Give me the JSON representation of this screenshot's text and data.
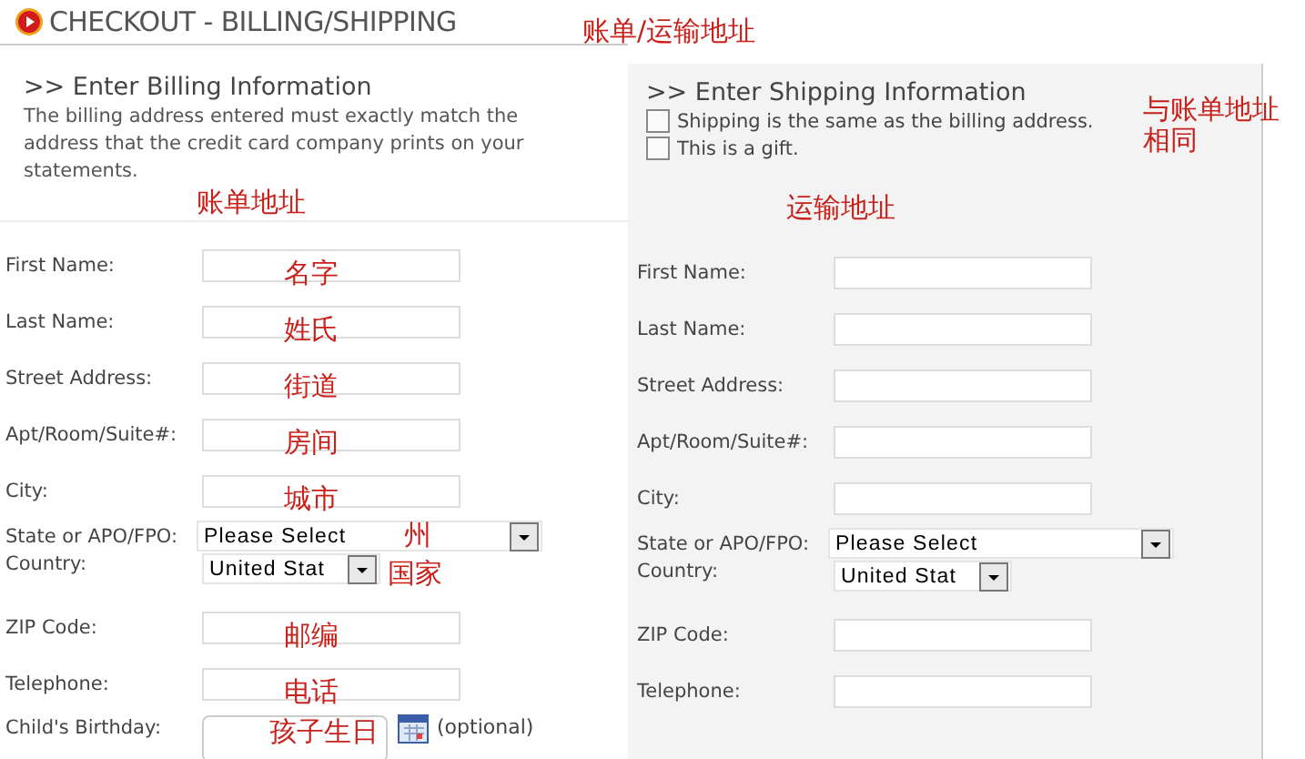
{
  "header": {
    "title": "CHECKOUT - BILLING/SHIPPING",
    "note": "账单/运输地址"
  },
  "billing": {
    "heading": ">> Enter Billing Information",
    "description": "The billing address entered must exactly match the address that the credit card company prints on your statements.",
    "note": "账单地址",
    "fields": [
      {
        "kind": "text",
        "label": "First Name:",
        "note": "名字"
      },
      {
        "kind": "text",
        "label": "Last Name:",
        "note": "姓氏"
      },
      {
        "kind": "text",
        "label": "Street Address:",
        "note": "街道"
      },
      {
        "kind": "text",
        "label": "Apt/Room/Suite#:",
        "note": "房间"
      },
      {
        "kind": "text",
        "label": "City:",
        "note": "城市"
      },
      {
        "kind": "select",
        "label": "State or APO/FPO:",
        "value": "Please Select",
        "note": "州"
      },
      {
        "kind": "country",
        "label": "Country:",
        "value": "United Stat",
        "note": "国家"
      },
      {
        "kind": "text",
        "label": "ZIP Code:",
        "note": "邮编"
      },
      {
        "kind": "text",
        "label": "Telephone:",
        "note": "电话"
      },
      {
        "kind": "date",
        "label": "Child's Birthday:",
        "hint": "(optional)",
        "note": "孩子生日"
      }
    ]
  },
  "shipping": {
    "heading": ">> Enter Shipping Information",
    "options": [
      {
        "label": "Shipping is the same as the billing address.",
        "checked": false
      },
      {
        "label": "This is a gift.",
        "checked": false
      }
    ],
    "options_note": "与账单地址相同",
    "note": "运输地址",
    "fields": [
      {
        "kind": "text",
        "label": "First Name:"
      },
      {
        "kind": "text",
        "label": "Last Name:"
      },
      {
        "kind": "text",
        "label": "Street Address:"
      },
      {
        "kind": "text",
        "label": "Apt/Room/Suite#:"
      },
      {
        "kind": "text",
        "label": "City:"
      },
      {
        "kind": "select",
        "label": "State or APO/FPO:",
        "value": "Please Select"
      },
      {
        "kind": "country",
        "label": "Country:",
        "value": "United Stat"
      },
      {
        "kind": "text",
        "label": "ZIP Code:"
      },
      {
        "kind": "text",
        "label": "Telephone:"
      }
    ]
  }
}
